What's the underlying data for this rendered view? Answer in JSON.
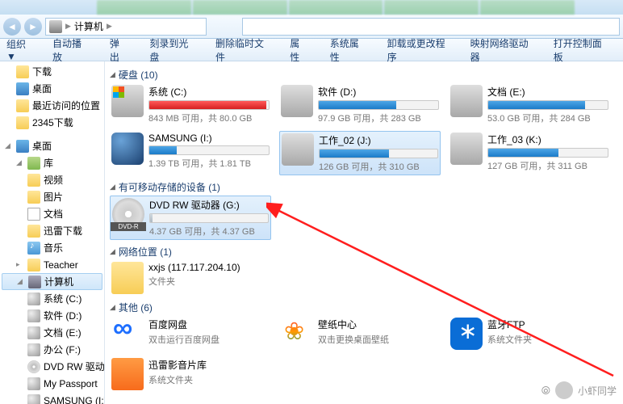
{
  "breadcrumb": {
    "item": "计算机"
  },
  "toolbar": {
    "org": "组织 ▼",
    "items": [
      "自动播放",
      "弹出",
      "刻录到光盘",
      "删除临时文件",
      "属性",
      "系统属性",
      "卸载或更改程序",
      "映射网络驱动器",
      "打开控制面板"
    ]
  },
  "tree": {
    "top": [
      {
        "icon": "ico-folder",
        "label": "下载"
      },
      {
        "icon": "ico-desktop",
        "label": "桌面"
      },
      {
        "icon": "ico-folder",
        "label": "最近访问的位置"
      },
      {
        "icon": "ico-folder",
        "label": "2345下载"
      }
    ],
    "desktop": "桌面",
    "lib": {
      "label": "库",
      "children": [
        {
          "icon": "ico-folder",
          "label": "视频"
        },
        {
          "icon": "ico-folder",
          "label": "图片"
        },
        {
          "icon": "ico-doc",
          "label": "文档"
        },
        {
          "icon": "ico-folder",
          "label": "迅雷下载"
        },
        {
          "icon": "ico-music",
          "label": "音乐"
        }
      ]
    },
    "teacher": "Teacher",
    "computer": {
      "label": "计算机",
      "children": [
        {
          "icon": "ico-disk",
          "label": "系统 (C:)"
        },
        {
          "icon": "ico-disk",
          "label": "软件 (D:)"
        },
        {
          "icon": "ico-disk",
          "label": "文档 (E:)"
        },
        {
          "icon": "ico-disk",
          "label": "办公 (F:)"
        },
        {
          "icon": "ico-dvd",
          "label": "DVD RW 驱动"
        },
        {
          "icon": "ico-disk",
          "label": "My Passport"
        },
        {
          "icon": "ico-disk",
          "label": "SAMSUNG (I:)"
        }
      ]
    }
  },
  "sections": {
    "hdd": "硬盘 (10)",
    "removable": "有可移动存储的设备 (1)",
    "network": "网络位置 (1)",
    "other": "其他 (6)"
  },
  "drives": {
    "row1": [
      {
        "name": "系统 (C:)",
        "info": "843 MB 可用，共 80.0 GB",
        "color": "red",
        "pct": 98,
        "ico": "drv-hdd win"
      },
      {
        "name": "软件 (D:)",
        "info": "97.9 GB 可用，共 283 GB",
        "color": "blue",
        "pct": 65,
        "ico": "drv-hdd"
      },
      {
        "name": "文档 (E:)",
        "info": "53.0 GB 可用，共 284 GB",
        "color": "blue",
        "pct": 81,
        "ico": "drv-hdd"
      }
    ],
    "row2": [
      {
        "name": "SAMSUNG (I:)",
        "info": "1.39 TB 可用，共 1.81 TB",
        "color": "blue",
        "pct": 23,
        "ico": "drv-ext"
      },
      {
        "name": "工作_02 (J:)",
        "info": "126 GB 可用，共 310 GB",
        "color": "blue",
        "pct": 59,
        "ico": "drv-hdd",
        "sel": true
      },
      {
        "name": "工作_03 (K:)",
        "info": "127 GB 可用，共 311 GB",
        "color": "blue",
        "pct": 59,
        "ico": "drv-hdd"
      }
    ],
    "dvd": {
      "name": "DVD RW 驱动器 (G:)",
      "info": "4.37 GB 可用，共 4.37 GB",
      "pct": 2
    },
    "net": {
      "name": "xxjs (117.117.204.10)",
      "info": "文件夹"
    },
    "others": [
      {
        "name": "百度网盘",
        "info": "双击运行百度网盘",
        "ico": "drv-baidu"
      },
      {
        "name": "壁纸中心",
        "info": "双击更换桌面壁纸",
        "ico": "drv-wall"
      },
      {
        "name": "蓝牙FTP",
        "info": "系统文件夹",
        "ico": "drv-bt"
      }
    ],
    "xunlei": {
      "name": "迅雷影音片库",
      "info": "系统文件夹"
    }
  },
  "watermark": "小虾同学"
}
